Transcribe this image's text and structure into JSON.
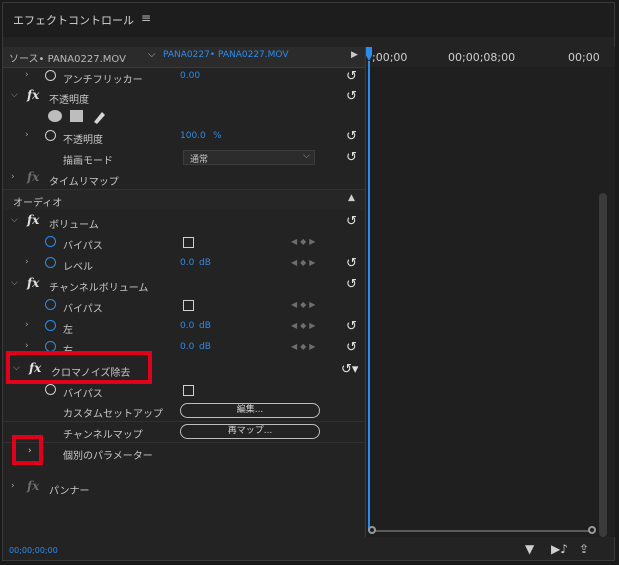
{
  "panel": {
    "title": "エフェクトコントロール",
    "menu_icon": "≡"
  },
  "source_bar": {
    "source_label": "ソース• PANA0227.MOV",
    "clip_label": "PANA0227• PANA0227.MOV"
  },
  "timeline": {
    "timecodes": [
      ";00;00",
      "00;00;08;00",
      "00;00"
    ]
  },
  "rows": {
    "antiflicker": {
      "label": "アンチフリッカー",
      "value": "0.00"
    },
    "opacity_fx": {
      "label": "不透明度"
    },
    "opacity_prop": {
      "label": "不透明度",
      "value": "100.0",
      "unit": "%"
    },
    "blend_mode": {
      "label": "描画モード",
      "value": "通常"
    },
    "time_remap": {
      "label": "タイムリマップ"
    },
    "audio_header": {
      "label": "オーディオ"
    },
    "volume_fx": {
      "label": "ボリューム"
    },
    "bypass1": {
      "label": "バイパス"
    },
    "level": {
      "label": "レベル",
      "value": "0.0",
      "unit": "dB"
    },
    "channel_volume_fx": {
      "label": "チャンネルボリューム"
    },
    "bypass2": {
      "label": "バイパス"
    },
    "left": {
      "label": "左",
      "value": "0.0",
      "unit": "dB"
    },
    "right": {
      "label": "右",
      "value": "0.0",
      "unit": "dB"
    },
    "chroma_fx": {
      "label": "クロマノイズ除去"
    },
    "bypass3": {
      "label": "バイパス"
    },
    "custom_setup": {
      "label": "カスタムセットアップ",
      "button": "編集..."
    },
    "channel_map": {
      "label": "チャンネルマップ",
      "button": "再マップ..."
    },
    "individual_params": {
      "label": "個別のパラメーター"
    },
    "panner_fx": {
      "label": "パンナー"
    }
  },
  "bottom": {
    "timecode": "00;00;00;00"
  },
  "colors": {
    "accent": "#2d8ceb",
    "highlight": "#e0001a"
  }
}
